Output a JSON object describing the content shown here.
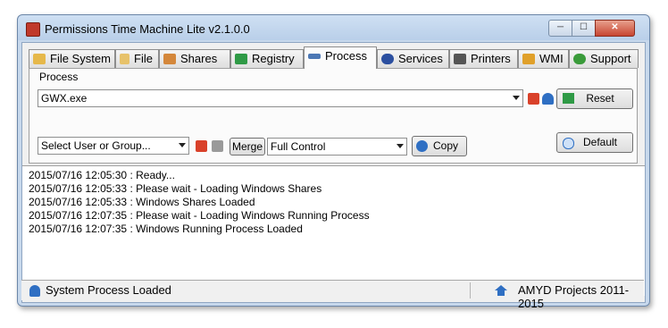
{
  "window": {
    "title": "Permissions Time Machine Lite v2.1.0.0",
    "controls": {
      "minimize": "─",
      "maximize": "☐",
      "close": "✕"
    }
  },
  "tabs": [
    {
      "label": "File System",
      "icon": "folder-icon",
      "color": "#e6b84a"
    },
    {
      "label": "File",
      "icon": "file-icon",
      "color": "#e7c26a"
    },
    {
      "label": "Shares",
      "icon": "shares-icon",
      "color": "#d4873b"
    },
    {
      "label": "Registry",
      "icon": "registry-icon",
      "color": "#2f9a46"
    },
    {
      "label": "Process",
      "icon": "process-icon",
      "color": "#4c78b5",
      "active": true
    },
    {
      "label": "Services",
      "icon": "services-icon",
      "color": "#2b4fa0"
    },
    {
      "label": "Printers",
      "icon": "printer-icon",
      "color": "#555555"
    },
    {
      "label": "WMI",
      "icon": "wmi-icon",
      "color": "#e0a02a"
    },
    {
      "label": "Support",
      "icon": "support-icon",
      "color": "#3a9b3a"
    }
  ],
  "process_group": {
    "label": "Process",
    "process_select": {
      "value": "GWX.exe"
    },
    "user_select": {
      "value": "Select User or Group..."
    },
    "merge_label": "Merge",
    "permission_select": {
      "value": "Full Control"
    },
    "copy_label": "Copy",
    "reset_label": "Reset",
    "default_label": "Default"
  },
  "log": [
    "2015/07/16 12:05:30 : Ready...",
    "2015/07/16 12:05:33 : Please wait - Loading Windows Shares",
    "2015/07/16 12:05:33 : Windows Shares Loaded",
    "2015/07/16 12:07:35 : Please wait - Loading Windows Running Process",
    "2015/07/16 12:07:35 : Windows Running Process Loaded"
  ],
  "status": {
    "left": "System Process Loaded",
    "right": "AMYD Projects 2011-2015"
  },
  "colors": {
    "accent_red": "#d9412a",
    "accent_blue": "#2f6fc3",
    "flag_green": "#2f9a46"
  }
}
